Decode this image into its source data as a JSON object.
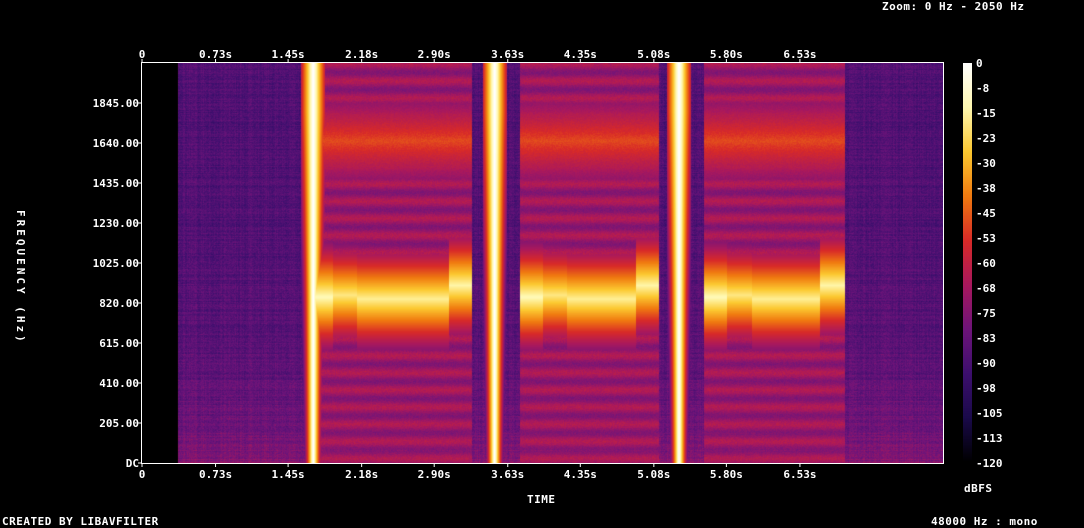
{
  "header": {
    "zoom_text": "Zoom: 0 Hz - 2050 Hz"
  },
  "footer": {
    "credit": "CREATED BY LIBAVFILTER",
    "format": "48000 Hz : mono"
  },
  "chart_data": {
    "type": "heatmap",
    "title": "",
    "xlabel": "TIME",
    "ylabel": "FREQUENCY (Hz)",
    "colorbar_label": "dBFS",
    "x_ticks": [
      "0",
      "0.73s",
      "1.45s",
      "2.18s",
      "2.90s",
      "3.63s",
      "4.35s",
      "5.08s",
      "5.80s",
      "6.53s"
    ],
    "x_tick_values": [
      0,
      0.73,
      1.45,
      2.18,
      2.9,
      3.63,
      4.35,
      5.08,
      5.8,
      6.53
    ],
    "xlim": [
      0,
      7.95
    ],
    "y_ticks": [
      "DC",
      "205.00",
      "410.00",
      "615.00",
      "820.00",
      "1025.00",
      "1230.00",
      "1435.00",
      "1640.00",
      "1845.00"
    ],
    "y_tick_values": [
      0,
      205,
      410,
      615,
      820,
      1025,
      1230,
      1435,
      1640,
      1845
    ],
    "ylim": [
      0,
      2050
    ],
    "colorbar_ticks": [
      "0",
      "-8",
      "-15",
      "-23",
      "-30",
      "-38",
      "-45",
      "-53",
      "-60",
      "-68",
      "-75",
      "-83",
      "-90",
      "-98",
      "-105",
      "-113",
      "-120"
    ],
    "colorbar_range": [
      -120,
      0
    ],
    "colormap": [
      "#000000",
      "#1a0a4a",
      "#3d0f6e",
      "#6e147a",
      "#a8185e",
      "#d82a28",
      "#f07a10",
      "#fcc830",
      "#fff8b0",
      "#ffffff"
    ],
    "silence_until_s": 0.36,
    "noise_floor_dbfs": -88,
    "tone_events": [
      {
        "start_s": 1.7,
        "end_s": 1.9,
        "freq_hz": 850,
        "level_dbfs": -12
      },
      {
        "start_s": 1.9,
        "end_s": 2.13,
        "freq_hz": 860,
        "level_dbfs": -18
      },
      {
        "start_s": 2.13,
        "end_s": 3.05,
        "freq_hz": 840,
        "level_dbfs": -16
      },
      {
        "start_s": 3.05,
        "end_s": 3.28,
        "freq_hz": 910,
        "level_dbfs": -14
      },
      {
        "start_s": 3.75,
        "end_s": 3.98,
        "freq_hz": 850,
        "level_dbfs": -12
      },
      {
        "start_s": 3.98,
        "end_s": 4.22,
        "freq_hz": 860,
        "level_dbfs": -18
      },
      {
        "start_s": 4.22,
        "end_s": 4.9,
        "freq_hz": 840,
        "level_dbfs": -16
      },
      {
        "start_s": 4.9,
        "end_s": 5.13,
        "freq_hz": 910,
        "level_dbfs": -14
      },
      {
        "start_s": 5.58,
        "end_s": 5.81,
        "freq_hz": 850,
        "level_dbfs": -12
      },
      {
        "start_s": 5.81,
        "end_s": 6.05,
        "freq_hz": 860,
        "level_dbfs": -18
      },
      {
        "start_s": 6.05,
        "end_s": 6.73,
        "freq_hz": 840,
        "level_dbfs": -16
      },
      {
        "start_s": 6.73,
        "end_s": 6.98,
        "freq_hz": 910,
        "level_dbfs": -14
      }
    ],
    "click_events_s": [
      1.7,
      3.5,
      5.33
    ]
  }
}
